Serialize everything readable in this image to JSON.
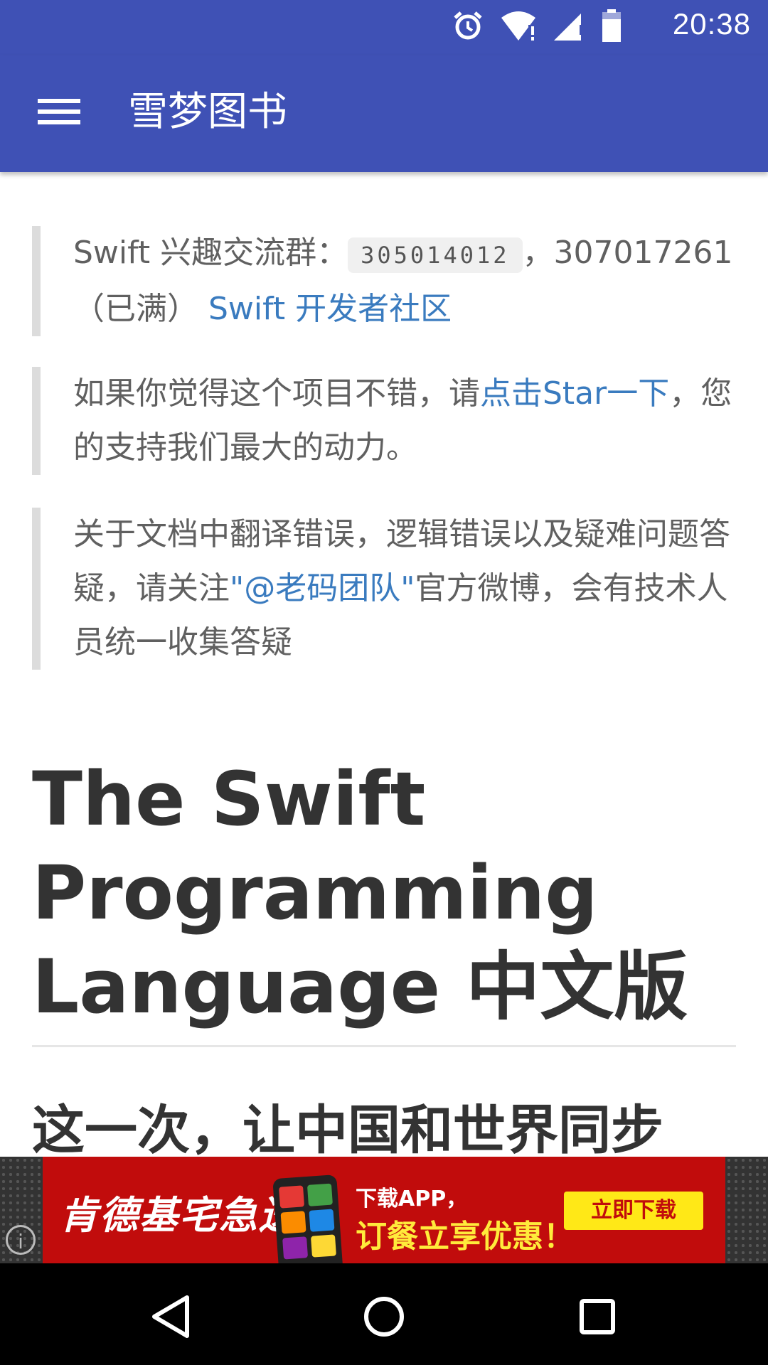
{
  "status_bar": {
    "time": "20:38",
    "icons": [
      "alarm-icon",
      "wifi-icon",
      "signal-icon",
      "battery-icon"
    ]
  },
  "app_bar": {
    "title": "雪梦图书",
    "menu_icon": "menu-icon"
  },
  "notices": [
    {
      "text_before": "Swift 兴趣交流群：",
      "code": "305014012",
      "text_after": "，307017261（已满）",
      "link": "Swift 开发者社区"
    },
    {
      "text_before": "如果你觉得这个项目不错，请",
      "link": "点击Star一下",
      "text_after": "，您的支持我们最大的动力。"
    },
    {
      "text_before": "关于文档中翻译错误，逻辑错误以及疑难问题答疑，请关注",
      "link": "\"@老码团队\"",
      "text_after": "官方微博，会有技术人员统一收集答疑"
    }
  ],
  "main": {
    "heading": "The Swift Programming Language 中文版",
    "subheading": "这一次，让中国和世界同步"
  },
  "ad": {
    "brand": "肯德基宅急送",
    "line1": "下载APP，",
    "line2": "订餐立享优惠！",
    "button": "立即下载",
    "info_icon": "i"
  },
  "colors": {
    "primary": "#3f51b5",
    "link": "#3a7bbf",
    "ad_red": "#c10c0c",
    "ad_yellow": "#ffe817"
  }
}
